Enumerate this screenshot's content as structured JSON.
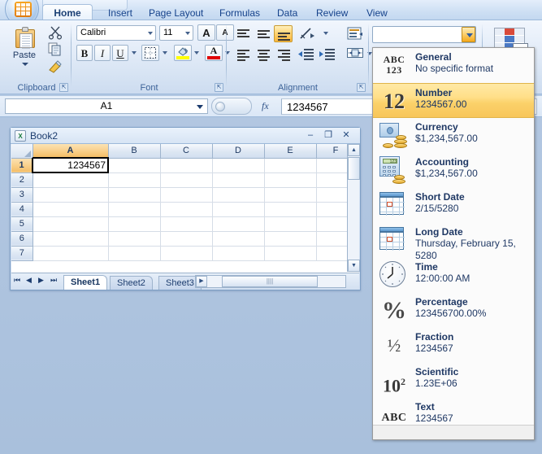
{
  "app": {
    "office_button": "office-logo",
    "quick_access_toolbar": "quick-access-toolbar"
  },
  "ribbon": {
    "tabs": [
      {
        "label": "Home",
        "active": true
      },
      {
        "label": "Insert",
        "active": false
      },
      {
        "label": "Page Layout",
        "active": false
      },
      {
        "label": "Formulas",
        "active": false
      },
      {
        "label": "Data",
        "active": false
      },
      {
        "label": "Review",
        "active": false
      },
      {
        "label": "View",
        "active": false
      }
    ],
    "groups": {
      "clipboard": {
        "label": "Clipboard",
        "paste_label": "Paste",
        "cut_icon": "scissors-icon",
        "copy_icon": "copy-icon",
        "format_painter_icon": "paintbrush-icon"
      },
      "font": {
        "label": "Font",
        "font_name": "Calibri",
        "font_size": "11",
        "grow_font": "A",
        "shrink_font": "A",
        "bold": "B",
        "italic": "I",
        "underline": "U"
      },
      "alignment": {
        "label": "Alignment"
      },
      "number": {
        "format_value": ""
      },
      "styles": {
        "icon": "cell-styles-icon",
        "badge": "≤≥"
      }
    }
  },
  "formula_bar": {
    "name_box": "A1",
    "fx_label": "fx",
    "formula_value": "1234567"
  },
  "workbook": {
    "title": "Book2",
    "minimize": "–",
    "maximize": "❐",
    "close": "✕",
    "columns": [
      "A",
      "B",
      "C",
      "D",
      "E",
      "F"
    ],
    "selected_column": "A",
    "rows": [
      "1",
      "2",
      "3",
      "4",
      "5",
      "6",
      "7"
    ],
    "selected_row": "1",
    "active_cell_value": "1234567",
    "sheet_tabs": [
      {
        "label": "Sheet1",
        "active": true
      },
      {
        "label": "Sheet2",
        "active": false
      },
      {
        "label": "Sheet3",
        "active": false
      }
    ],
    "nav_first": "⏮",
    "nav_prev": "◀",
    "nav_next": "▶",
    "nav_last": "⏭",
    "scroll_up": "▲",
    "scroll_down": "▼",
    "hthumb_grip": "||||"
  },
  "number_format_dropdown": {
    "items": [
      {
        "name": "General",
        "sample": "No specific format",
        "icon": "abc123-icon",
        "selected": false
      },
      {
        "name": "Number",
        "sample": "1234567.00",
        "icon": "number-12-icon",
        "selected": true
      },
      {
        "name": "Currency",
        "sample": "$1,234,567.00",
        "icon": "currency-icon",
        "selected": false
      },
      {
        "name": "Accounting",
        "sample": " $1,234,567.00",
        "icon": "accounting-icon",
        "selected": false
      },
      {
        "name": "Short Date",
        "sample": "2/15/5280",
        "icon": "calendar-icon",
        "selected": false
      },
      {
        "name": "Long Date",
        "sample": "Thursday, February 15, 5280",
        "icon": "calendar-icon",
        "selected": false
      },
      {
        "name": "Time",
        "sample": "12:00:00 AM",
        "icon": "clock-icon",
        "selected": false
      },
      {
        "name": "Percentage",
        "sample": "123456700.00%",
        "icon": "percent-icon",
        "selected": false
      },
      {
        "name": "Fraction",
        "sample": "1234567",
        "icon": "fraction-icon",
        "selected": false
      },
      {
        "name": "Scientific",
        "sample": "1.23E+06",
        "icon": "scientific-icon",
        "selected": false
      },
      {
        "name": "Text",
        "sample": "1234567",
        "icon": "abc-icon",
        "selected": false
      }
    ]
  },
  "colors": {
    "accent_orange": "#f8c65a",
    "ribbon_blue": "#d6e3f3",
    "text_navy": "#1f3864",
    "workspace_bg": "#a8c0dd"
  }
}
